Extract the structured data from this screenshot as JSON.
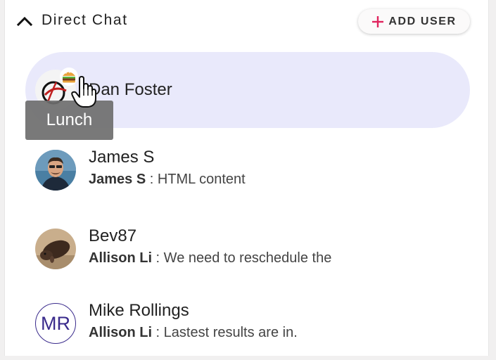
{
  "section": {
    "title": "Direct Chat",
    "add_user_label": "ADD USER",
    "collapse_icon": "chevron-up-icon"
  },
  "chats": [
    {
      "name": "Dan Foster",
      "active": true,
      "avatar": "logo-avatar",
      "status_tooltip": "Lunch",
      "status_icon": "burger-icon"
    },
    {
      "name": "James S",
      "preview_sender": "James S",
      "preview_text": "HTML content",
      "avatar": "photo-avatar"
    },
    {
      "name": "Bev87",
      "preview_sender": "Allison Li",
      "preview_text": "We need to reschedule the",
      "avatar": "photo-avatar"
    },
    {
      "name": "Mike Rollings",
      "preview_sender": "Allison Li",
      "preview_text": "Lastest results are in.",
      "initials": "MR"
    }
  ],
  "colors": {
    "active_item_bg": "#e9e9fb",
    "accent_plus": "#e0245e",
    "initials_color": "#3a2b8c"
  }
}
